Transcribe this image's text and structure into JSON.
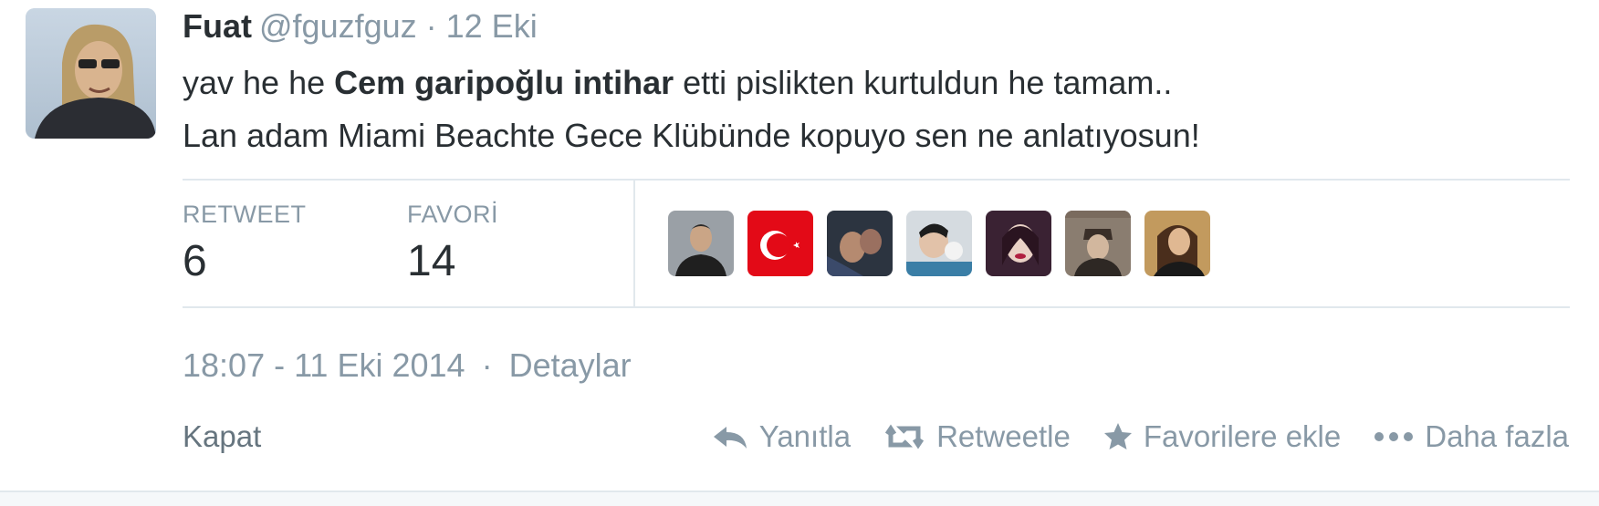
{
  "tweet": {
    "author_name": "Fuat",
    "handle": "@fguzfguz",
    "separator": "·",
    "date": "12 Eki",
    "text_line1_pre": "yav he he ",
    "text_line1_bold": "Cem garipoğlu intihar",
    "text_line1_post": " etti pislikten kurtuldun he tamam..",
    "text_line2": "Lan adam Miami Beachte Gece Klübünde kopuyo sen ne anlatıyosun!"
  },
  "stats": {
    "retweet_label": "RETWEET",
    "retweet_count": "6",
    "favorite_label": "FAVORİ",
    "favorite_count": "14"
  },
  "favoriters": [
    {
      "name": "user-avatar-1"
    },
    {
      "name": "turkish-flag-avatar"
    },
    {
      "name": "user-avatar-3"
    },
    {
      "name": "user-avatar-4"
    },
    {
      "name": "user-avatar-5"
    },
    {
      "name": "ataturk-avatar"
    },
    {
      "name": "user-avatar-7"
    }
  ],
  "meta": {
    "timestamp": "18:07 - 11 Eki 2014",
    "separator": "·",
    "details_link": "Detaylar"
  },
  "actions": {
    "close": "Kapat",
    "reply": "Yanıtla",
    "retweet": "Retweetle",
    "favorite": "Favorilere ekle",
    "more": "Daha fazla"
  },
  "colors": {
    "text": "#292f33",
    "muted": "#8899a6",
    "divider": "#e1e8ed",
    "flag_red": "#e30a17"
  }
}
